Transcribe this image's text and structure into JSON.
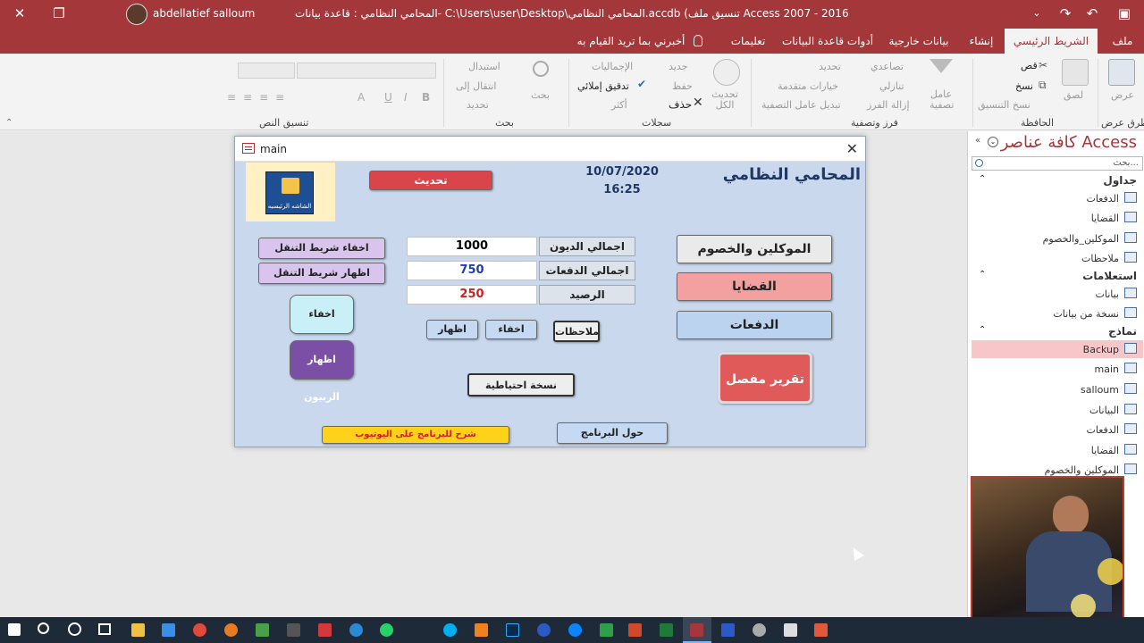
{
  "window": {
    "title": "المحامي النظامي : قاعدة بيانات- C:\\Users\\user\\Desktop\\المحامي النظامي.accdb (تنسيق ملف Access 2007 - 2016)  -  Access",
    "user_name": "abdellatief salloum"
  },
  "tabs": [
    "ملف",
    "الشريط الرئيسي",
    "إنشاء",
    "بيانات خارجية",
    "أدوات قاعدة البيانات",
    "تعليمات",
    "أخبرني بما تريد القيام به"
  ],
  "ribbon": {
    "groups": {
      "views": "طرق عرض",
      "clipboard": "الحافظة",
      "sort_filter": "فرز وتصفية",
      "records": "سجلات",
      "find": "بحث",
      "text_formatting": "تنسيق النص"
    },
    "items": {
      "view": "عرض",
      "paste": "لصق",
      "cut": "قص",
      "copy": "نسخ",
      "format_painter": "نسخ التنسيق",
      "filter": "عامل تصفية",
      "ascending": "تصاعدي",
      "descending": "تنازلي",
      "remove_sort": "إزالة الفرز",
      "selection": "تحديد",
      "advanced": "خيارات متقدمة",
      "toggle_filter": "تبديل عامل التصفية",
      "refresh_all": "تحديث الكل",
      "new": "جديد",
      "save": "حفظ",
      "delete": "حذف",
      "totals": "الإجماليات",
      "spelling": "تدقيق إملائي",
      "more": "أكثر",
      "find": "بحث",
      "replace": "استبدال",
      "goto": "انتقال إلى",
      "select": "تحديد"
    }
  },
  "form": {
    "caption": "main",
    "app_title": "المحامي النظامي",
    "date": "10/07/2020",
    "time": "16:25",
    "logo_text": "الشاشه الرئيسيه",
    "refresh_button": "تحديث",
    "clients_button": "الموكلين والخصوم",
    "cases_button": "القضايا",
    "payments_button": "الدفعات",
    "detailed_report_button": "تقرير مفصل",
    "total_debts_label": "اجمالي الديون",
    "total_debts_value": "1000",
    "total_payments_label": "اجمالي الدفعات",
    "total_payments_value": "750",
    "balance_label": "الرصيد",
    "balance_value": "250",
    "notes_button": "ملاحظات",
    "hide_button": "اخفاء",
    "show_button": "اظهار",
    "hide_nav_button": "اخفاء شريط التنقل",
    "show_nav_button": "اظهار شريط التنقل",
    "hide_ribbon_button": "اخفاء الربيون",
    "show_ribbon_button": "اظهار الربيون",
    "backup_button": "نسخة احتياطية",
    "about_button": "حول البرنامج",
    "youtube_button": "شرح للبرنامج على اليوتيوب"
  },
  "nav": {
    "title": "كافة عناصر Access",
    "search_placeholder": "بحث...",
    "sections": {
      "tables": "جداول",
      "queries": "استعلامات",
      "forms": "نماذج"
    },
    "tables": [
      "الدفعات",
      "القضايا",
      "الموكلين_والخصوم",
      "ملاحظات"
    ],
    "queries": [
      "بيانات",
      "نسخة من بيانات"
    ],
    "forms": [
      "Backup",
      "main",
      "salloum",
      "البيانات",
      "الدفعات",
      "القضايا",
      "الموكلين والخصوم"
    ]
  },
  "colors": {
    "accent": "#a4373a",
    "form_bg": "#c9d8ed"
  }
}
